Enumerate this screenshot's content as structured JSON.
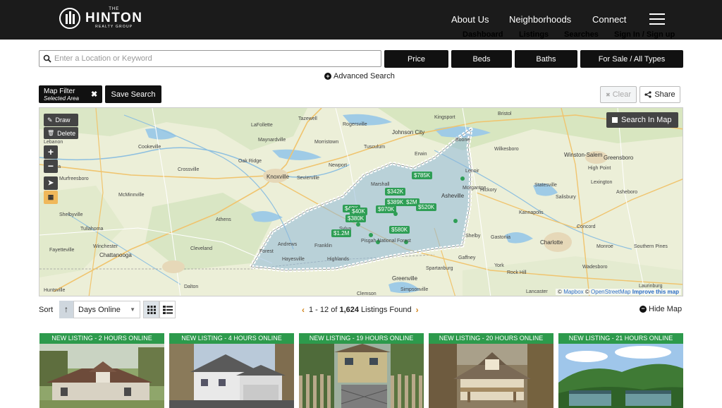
{
  "header": {
    "logo": {
      "the": "THE",
      "name": "HINTON",
      "sub": "REALTY GROUP"
    },
    "nav": [
      "About Us",
      "Neighborhoods",
      "Connect"
    ],
    "subnav": [
      "Dashboard",
      "Listings",
      "Searches",
      "Sign In / Sign up"
    ]
  },
  "search": {
    "placeholder": "Enter a Location or Keyword",
    "filters": [
      "Price",
      "Beds",
      "Baths",
      "For Sale / All Types"
    ],
    "advanced": "Advanced Search"
  },
  "filter_bar": {
    "chip_title": "Map Filter",
    "chip_sub": "Selected Area",
    "save": "Save Search",
    "clear": "Clear",
    "share": "Share"
  },
  "map": {
    "tools": {
      "draw": "Draw",
      "delete": "Delete"
    },
    "search_in_map": "Search In Map",
    "attribution": {
      "mapbox": "Mapbox",
      "osm": "OpenStreetMap",
      "improve": "Improve this map"
    },
    "cities": [
      "Knoxville",
      "Asheville",
      "Greenville",
      "Charlotte",
      "Chattanooga",
      "Winston-Salem",
      "Greensboro",
      "Johnson City"
    ],
    "places": [
      "LaFollette",
      "Tazewell",
      "Rogersville",
      "Kingsport",
      "Bristol",
      "Maynardville",
      "Morristown",
      "Tusculum",
      "Lebanon",
      "Cookeville",
      "Oak Ridge",
      "Sevierville",
      "Newport",
      "Wilkesboro",
      "Boone",
      "High Point",
      "Smyrna",
      "Murfreesboro",
      "Crossville",
      "Marshall",
      "Lenoir",
      "Hickory",
      "Statesville",
      "Salisbury",
      "Lexington",
      "Asheboro",
      "McMinnville",
      "Morganton",
      "Kannapolis",
      "Shelbyville",
      "Tullahoma",
      "Athens",
      "Shelby",
      "Gastonia",
      "Concord",
      "Winchester",
      "Cleveland",
      "Andrews",
      "Franklin",
      "Pisgah National Forest",
      "Fayetteville",
      "Hayesville",
      "Highlands",
      "Gaffney",
      "York",
      "Monroe",
      "Southern Pines",
      "Rock Hill",
      "Spartanburg",
      "Wadesboro",
      "Huntsville",
      "Dalton",
      "Clemson",
      "Simpsonville",
      "Lancaster",
      "Laurinburg",
      "Forest",
      "Sylva",
      "Erwin"
    ],
    "markers": [
      "$785K",
      "$342K",
      "$389K",
      "$2M",
      "$48K",
      "$970K",
      "$520K",
      "$380K",
      "$1.2M",
      "$580K",
      "$40K"
    ]
  },
  "results": {
    "sort_label": "Sort",
    "sort_arrow": "↑",
    "sort_value": "Days Online",
    "range": "1 - 12",
    "of": "of",
    "total": "1,624",
    "suffix": "Listings Found",
    "hide_map": "Hide Map"
  },
  "listings": [
    {
      "banner": "NEW LISTING - 2 HOURS ONLINE"
    },
    {
      "banner": "NEW LISTING - 4 HOURS ONLINE"
    },
    {
      "banner": "NEW LISTING - 19 HOURS ONLINE"
    },
    {
      "banner": "NEW LISTING - 20 HOURS ONLINE"
    },
    {
      "banner": "NEW LISTING - 21 HOURS ONLINE"
    }
  ],
  "colors": {
    "header_bg": "#1b1b1b",
    "banner_green": "#2d9a4c",
    "marker_green": "#2e9e55",
    "pager_arrow": "#d4861c"
  }
}
